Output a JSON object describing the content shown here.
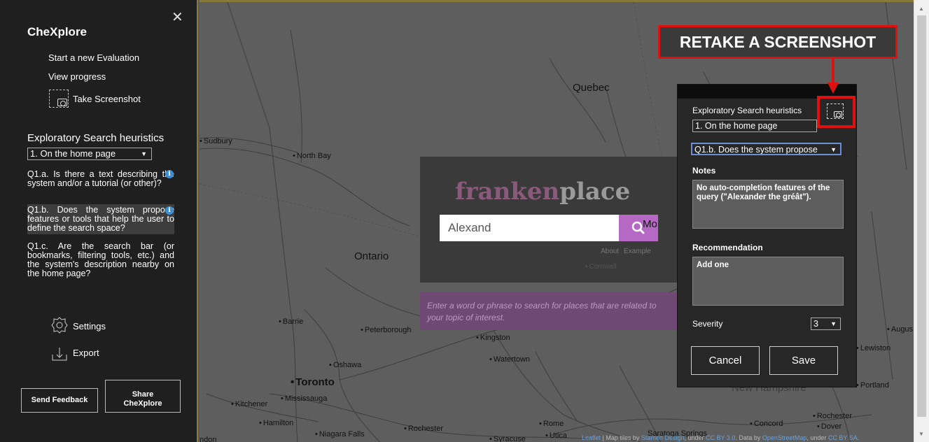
{
  "sidebar": {
    "title": "CheXplore",
    "close_glyph": "✕",
    "menu": {
      "new_eval": "Start a new Evaluation",
      "progress": "View progress",
      "screenshot": "Take Screenshot"
    },
    "heuristics_title": "Exploratory Search heuristics",
    "section_select": "1. On the home page",
    "questions": [
      "Q1.a. Is there a text describing the system and/or a tutorial (or other)?",
      "Q1.b. Does the system propose features or tools that help the user to define the search space?",
      "Q1.c. Are the search bar (or bookmarks, filtering tools, etc.) and the system's description nearby on the home page?"
    ],
    "settings": "Settings",
    "export": "Export",
    "send_feedback": "Send Feedback",
    "share_line1": "Share",
    "share_line2": "CheXplore"
  },
  "map": {
    "cities": {
      "quebec": "Quebec",
      "sudbury": "Sudbury",
      "north_bay": "North Bay",
      "ontario": "Ontario",
      "barrie": "Barrie",
      "peterborough": "Peterborough",
      "kingston": "Kingston",
      "watertown": "Watertown",
      "oshawa": "Oshawa",
      "toronto": "Toronto",
      "mississauga": "Mississauga",
      "kitchener": "Kitchener",
      "hamilton": "Hamilton",
      "niagara_falls": "Niagara Falls",
      "rochester_ny": "Rochester",
      "rome": "Rome",
      "utica": "Utica",
      "syracuse": "Syracuse",
      "saratoga": "Saratoga Springs",
      "concord": "Concord",
      "rochester_nh": "Rochester",
      "dover": "Dover",
      "portland": "Portland",
      "lewiston": "Lewiston",
      "augusta": "Augus",
      "cornwall": "Cornwall",
      "mo": "Mo",
      "london": "ndon",
      "new_hampshire": "New Hampshire"
    },
    "attribution": {
      "leaflet": "Leaflet",
      "t1": " | Map tiles by ",
      "stamen": "Stamen Design",
      "t2": ", under ",
      "ccby": "CC BY 3.0",
      "t3": ". Data by ",
      "osm": "OpenStreetMap",
      "t4": ", under ",
      "ccbysa": "CC BY SA",
      "t5": "."
    }
  },
  "frankenplace": {
    "logo_a": "franken",
    "logo_b": "place",
    "search_value": "Alexand",
    "about": "About",
    "example": "Example",
    "hint": "Enter a word or phrase to search for places that are related to your topic of interest."
  },
  "panel": {
    "heuristics_title": "Exploratory Search heuristics",
    "section_select": "1. On the home page",
    "question_select": "Q1.b. Does the system propose",
    "notes_label": "Notes",
    "notes_value": "No auto-completion features of the query (\"Alexander the gréât\").",
    "recommendation_label": "Recommendation",
    "recommendation_value": "Add one",
    "severity_label": "Severity",
    "severity_value": "3",
    "cancel": "Cancel",
    "save": "Save"
  },
  "annotation": {
    "label": "RETAKE A SCREENSHOT",
    "color": "#e01010"
  },
  "colors": {
    "sidebar_bg": "#1f1f1f",
    "accent_purple": "#b569c4",
    "info_blue": "#3a8fd6"
  }
}
